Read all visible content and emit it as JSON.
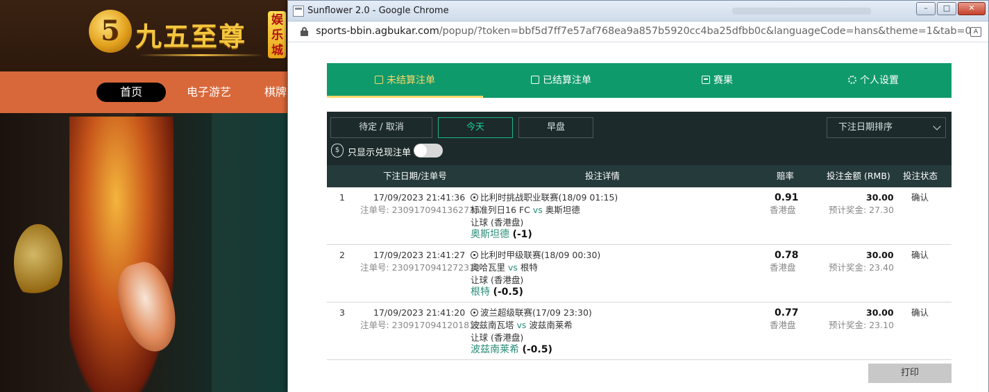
{
  "background_site": {
    "logo_mark": "5",
    "logo_text": "九五至尊",
    "logo_badge": "娱乐城",
    "nav": [
      {
        "label": "首页",
        "active": true
      },
      {
        "label": "电子游艺",
        "active": false
      },
      {
        "label": "棋牌",
        "active": false
      }
    ]
  },
  "window": {
    "title": "Sunflower 2.0 - Google Chrome",
    "controls": {
      "minimize": "–",
      "maximize": "□",
      "close": "✕"
    },
    "url_host": "sports-bbin.agbukar.com",
    "url_rest": "/popup/?token=bbf5d7ff7e57af768ea9a857b5920cc4ba25dfbb0c&languageCode=hans&theme=1&tab=0"
  },
  "tabs": [
    {
      "label": "未结算注单",
      "icon": "doc-icon",
      "active": true
    },
    {
      "label": "已结算注单",
      "icon": "check-doc-icon",
      "active": false
    },
    {
      "label": "赛果",
      "icon": "scoreboard-icon",
      "active": false
    },
    {
      "label": "个人设置",
      "icon": "gear-icon",
      "active": false
    }
  ],
  "filters": {
    "buttons": [
      {
        "label": "待定 / 取消",
        "active": false
      },
      {
        "label": "今天",
        "active": true
      },
      {
        "label": "早盘",
        "active": false
      }
    ],
    "sort_label": "下注日期排序",
    "cashout_label": "只显示兑现注单",
    "cashout_enabled": false
  },
  "table": {
    "headers": {
      "date": "下注日期/注单号",
      "detail": "投注详情",
      "odds": "赔率",
      "amount": "投注金额 (RMB)",
      "status": "投注状态"
    },
    "rows": [
      {
        "index": "1",
        "datetime": "17/09/2023 21:41:36",
        "bet_no": "注单号: 2309170941362735",
        "league": "比利时挑战职业联赛(18/09 01:15)",
        "home": "标准列日16 FC",
        "vs": "vs",
        "away": "奥斯坦德",
        "market": "让球 (香港盘)",
        "pick": "奥斯坦德",
        "handicap": "(-1)",
        "odds": "0.91",
        "odds_type": "香港盘",
        "stake": "30.00",
        "payout": "预计奖金: 27.30",
        "status": "确认"
      },
      {
        "index": "2",
        "datetime": "17/09/2023 21:41:27",
        "bet_no": "注单号: 2309170941272312",
        "league": "比利时甲级联赛(18/09 00:30)",
        "home": "奥哈瓦里",
        "vs": "vs",
        "away": "根特",
        "market": "让球 (香港盘)",
        "pick": "根特",
        "handicap": "(-0.5)",
        "odds": "0.78",
        "odds_type": "香港盘",
        "stake": "30.00",
        "payout": "预计奖金: 23.40",
        "status": "确认"
      },
      {
        "index": "3",
        "datetime": "17/09/2023 21:41:20",
        "bet_no": "注单号: 2309170941201812",
        "league": "波兰超级联赛(17/09 23:30)",
        "home": "波兹南瓦塔",
        "vs": "vs",
        "away": "波兹南莱希",
        "market": "让球 (香港盘)",
        "pick": "波兹南莱希",
        "handicap": "(-0.5)",
        "odds": "0.77",
        "odds_type": "香港盘",
        "stake": "30.00",
        "payout": "预计奖金: 23.10",
        "status": "确认"
      }
    ]
  },
  "print_label": "打印",
  "colors": {
    "tab_bar": "#0f9a6c",
    "tab_active_text": "#ffd86a",
    "filter_bar": "#1c2a2b",
    "table_header": "#253a3b",
    "accent": "#19d09a",
    "nav_bar": "#d8683a"
  }
}
